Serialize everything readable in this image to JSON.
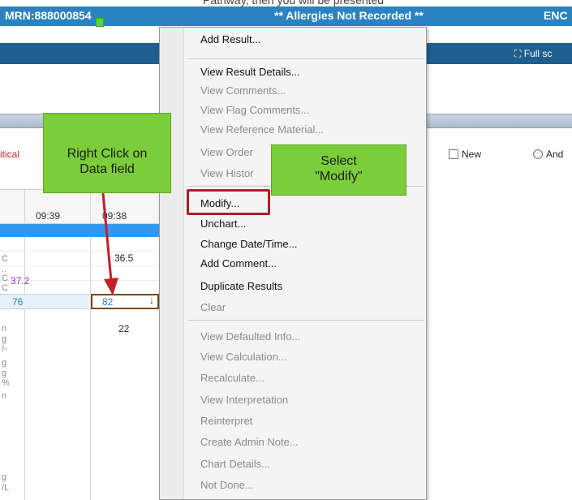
{
  "header": {
    "top_text": "Pathway, then you will be presented",
    "mrn": "MRN:888000854",
    "allergies": "** Allergies Not Recorded **",
    "enc": "ENC"
  },
  "toolbar": {
    "full_screen": "Full sc",
    "full_screen_icon": "fullscreen-icon"
  },
  "filters": {
    "critical": "itical",
    "new": "New",
    "and": "And"
  },
  "grid": {
    "times": [
      "09:39",
      "09:38"
    ],
    "units": [
      "C",
      "..",
      "C",
      "C",
      "",
      "n",
      "g",
      "/-",
      "g",
      "g",
      "%",
      "n",
      "",
      "g",
      "/L"
    ],
    "values": {
      "temp_1": "36.5",
      "temp_2": "37.2",
      "hr_prev": "76",
      "hr_curr": "82",
      "rr": "22"
    },
    "down_arrow_icon": "down-arrow-icon"
  },
  "callouts": {
    "right_click": "Right Click on Data field",
    "select_modify": "Select \"Modify\""
  },
  "context_menu": {
    "items": [
      {
        "label": "Add Result...",
        "enabled": true
      },
      {
        "label": "View Result Details...",
        "enabled": true
      },
      {
        "label": "View Comments...",
        "enabled": false
      },
      {
        "label": "View Flag Comments...",
        "enabled": false
      },
      {
        "label": "View Reference Material...",
        "enabled": false
      },
      {
        "label": "View Order",
        "enabled": false
      },
      {
        "label": "View Histor",
        "enabled": false
      },
      {
        "label": "Modify...",
        "enabled": true
      },
      {
        "label": "Unchart...",
        "enabled": true
      },
      {
        "label": "Change Date/Time...",
        "enabled": true
      },
      {
        "label": "Add Comment...",
        "enabled": true
      },
      {
        "label": "Duplicate Results",
        "enabled": true
      },
      {
        "label": "Clear",
        "enabled": false
      },
      {
        "label": "View Defaulted Info...",
        "enabled": false
      },
      {
        "label": "View Calculation...",
        "enabled": false
      },
      {
        "label": "Recalculate...",
        "enabled": false
      },
      {
        "label": "View Interpretation",
        "enabled": false
      },
      {
        "label": "Reinterpret",
        "enabled": false
      },
      {
        "label": "Create Admin Note...",
        "enabled": false
      },
      {
        "label": "Chart Details...",
        "enabled": false
      },
      {
        "label": "Not Done...",
        "enabled": false
      }
    ]
  },
  "colors": {
    "header_blue": "#2a82c0",
    "callout_green": "#7ccd3a",
    "highlight_red": "#a8202a",
    "row_selected": "#3399ee"
  }
}
